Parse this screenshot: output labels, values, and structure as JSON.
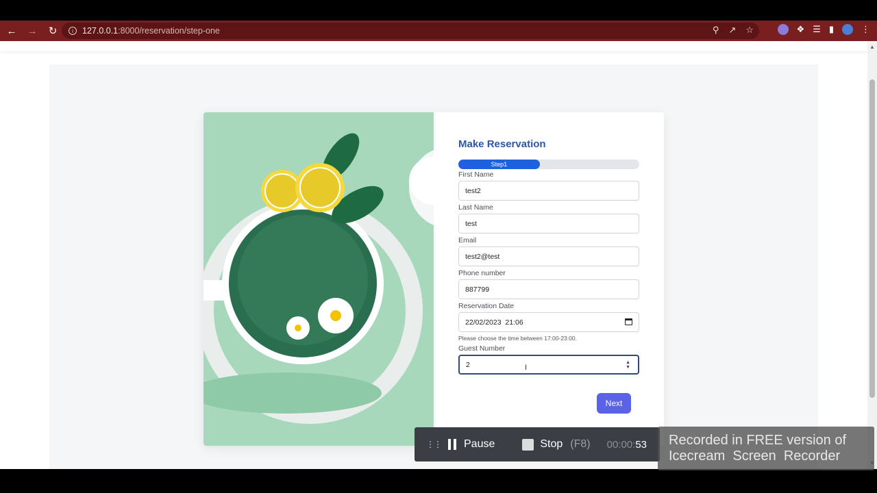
{
  "browser": {
    "url_host": "127.0.0.1",
    "url_path": ":8000/reservation/step-one"
  },
  "form": {
    "title": "Make Reservation",
    "progress_label": "Step1",
    "progress_fraction": 0.45,
    "fields": {
      "first_name": {
        "label": "First Name",
        "value": "test2"
      },
      "last_name": {
        "label": "Last Name",
        "value": "test"
      },
      "email": {
        "label": "Email",
        "value": "test2@test"
      },
      "phone": {
        "label": "Phone number",
        "value": "887799"
      },
      "reservation_date": {
        "label": "Reservation Date",
        "value": "22/02/2023  21:06"
      },
      "date_hint": "Please choose the time between 17:00-23:00.",
      "guest_number": {
        "label": "Guest Number",
        "value": "2"
      }
    },
    "next_label": "Next"
  },
  "recorder": {
    "pause_label": "Pause",
    "stop_label": "Stop",
    "stop_key": "(F8)",
    "time_dim": "00:00:",
    "time_bright": "53"
  },
  "watermark": {
    "line1": "Recorded in FREE version of",
    "line2": "Icecream  Screen  Recorder"
  },
  "colors": {
    "toolbar": "#7a1f1f",
    "title": "#2a57a8",
    "progress": "#1f5fe0",
    "next_button": "#5a63e6",
    "illustration_bg": "#a8d8bc"
  }
}
